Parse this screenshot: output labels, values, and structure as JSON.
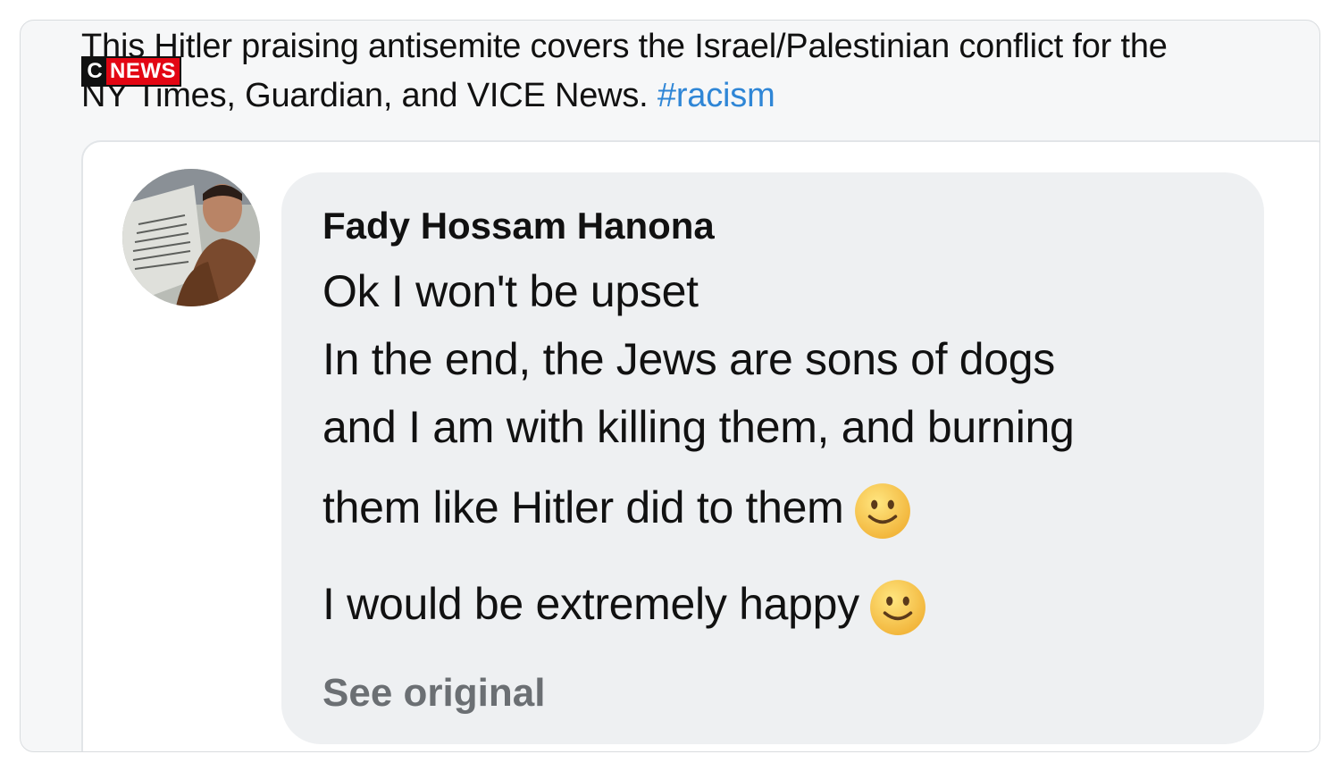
{
  "tweet": {
    "line1": "This Hitler praising antisemite covers the Israel/Palestinian conflict for the",
    "line2": "NY Times, Guardian, and VICE News. ",
    "hashtag": "#racism"
  },
  "watermark": {
    "c": "C",
    "news": "NEWS"
  },
  "comment": {
    "author": "Fady Hossam Hanona",
    "lines": [
      "Ok I won't be upset",
      "In the end, the Jews are sons of dogs",
      "and I am with killing them, and burning",
      "them like Hitler did to them",
      "I would be extremely happy"
    ],
    "see_original": "See original"
  },
  "colors": {
    "hashtag": "#2f86d6",
    "bubble": "#eef0f2",
    "cnews_red": "#e30613"
  },
  "icons": [
    "slightly-smiling-face-emoji",
    "slightly-smiling-face-emoji"
  ]
}
